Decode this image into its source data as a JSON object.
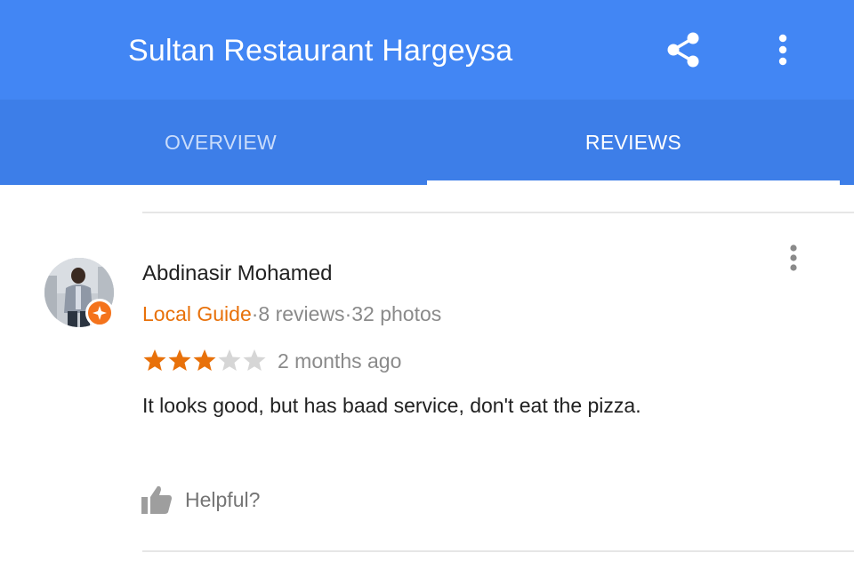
{
  "appbar": {
    "title": "Sultan Restaurant Hargeysa",
    "share_icon": "share-icon",
    "more_icon": "more-vert-icon",
    "color": "#4286f4"
  },
  "tabs": [
    {
      "label": "OVERVIEW",
      "selected": false
    },
    {
      "label": "REVIEWS",
      "selected": true
    }
  ],
  "review": {
    "author": "Abdinasir Mohamed",
    "badge": "Local Guide",
    "reviews_count": "·8 reviews",
    "photos_count": "·32 photos",
    "rating": 3,
    "max_rating": 5,
    "time": "2 months ago",
    "text": "It looks good, but has baad service, don't eat the pizza.",
    "helpful_label": "Helpful?",
    "helpful_icon": "thumb-up-icon",
    "menu_icon": "more-vert-icon"
  },
  "colors": {
    "star_filled": "#e8710a",
    "star_empty": "#d6d6d6",
    "local_guide": "#e8710a"
  }
}
